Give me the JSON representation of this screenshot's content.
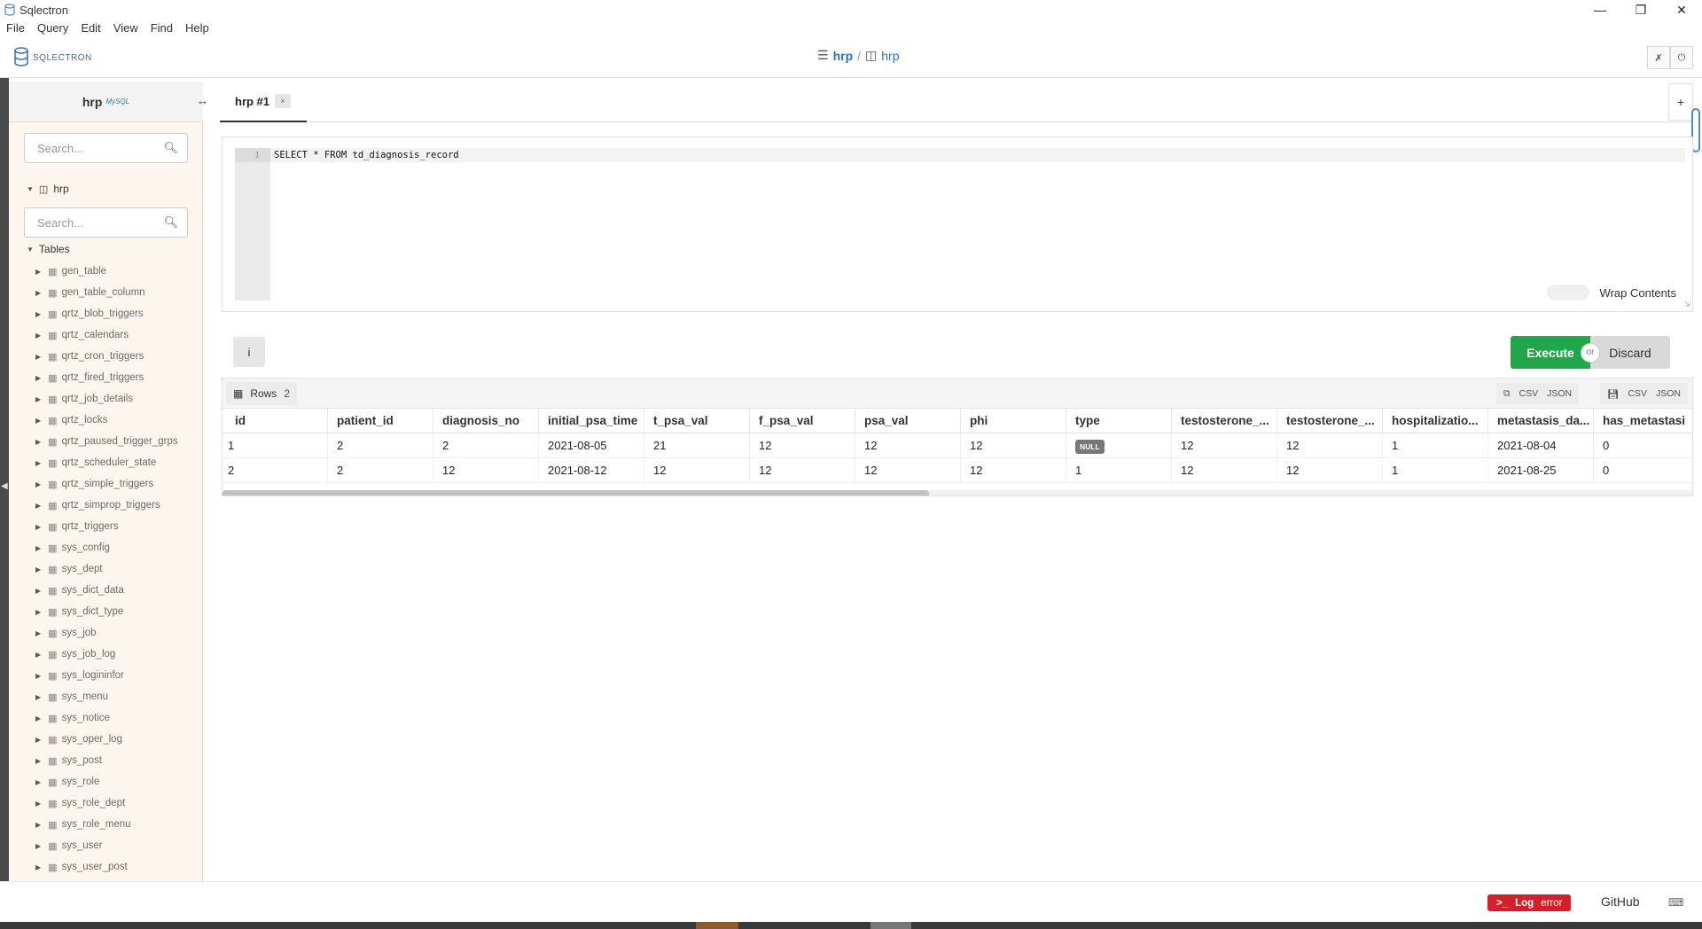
{
  "window": {
    "title": "Sqlectron",
    "controls": [
      "minimize-icon",
      "restore-icon",
      "close-icon"
    ]
  },
  "menu": [
    "File",
    "Query",
    "Edit",
    "View",
    "Find",
    "Help"
  ],
  "header": {
    "logo_text": "SQLECTRON",
    "server": "hrp",
    "separator": "/",
    "database": "hrp"
  },
  "sidebar": {
    "title": "hrp",
    "engine": "MySQL",
    "search_placeholder": "Search...",
    "db_name": "hrp",
    "table_search_placeholder": "Search...",
    "tables_label": "Tables",
    "tables": [
      "gen_table",
      "gen_table_column",
      "qrtz_blob_triggers",
      "qrtz_calendars",
      "qrtz_cron_triggers",
      "qrtz_fired_triggers",
      "qrtz_job_details",
      "qrtz_locks",
      "qrtz_paused_trigger_grps",
      "qrtz_scheduler_state",
      "qrtz_simple_triggers",
      "qrtz_simprop_triggers",
      "qrtz_triggers",
      "sys_config",
      "sys_dept",
      "sys_dict_data",
      "sys_dict_type",
      "sys_job",
      "sys_job_log",
      "sys_logininfor",
      "sys_menu",
      "sys_notice",
      "sys_oper_log",
      "sys_post",
      "sys_role",
      "sys_role_dept",
      "sys_role_menu",
      "sys_user",
      "sys_user_post"
    ]
  },
  "tabs": [
    {
      "label": "hrp #1",
      "close": "×"
    }
  ],
  "add_tab": "+",
  "editor": {
    "line_number": "1",
    "query": "SELECT * FROM td_diagnosis_record",
    "wrap_label": "Wrap Contents"
  },
  "actions": {
    "info": "i",
    "execute": "Execute",
    "or": "or",
    "discard": "Discard"
  },
  "results": {
    "rows_label": "Rows",
    "rows_count": "2",
    "csv": "CSV",
    "json": "JSON",
    "columns": [
      "id",
      "patient_id",
      "diagnosis_no",
      "initial_psa_time",
      "t_psa_val",
      "f_psa_val",
      "psa_val",
      "phi",
      "type",
      "testosterone_...",
      "testosterone_...",
      "hospitalizatio...",
      "metastasis_da...",
      "has_metastasi"
    ],
    "rows": [
      [
        "1",
        "2",
        "2",
        "2021-08-05",
        "21",
        "12",
        "12",
        "12",
        "NULL",
        "12",
        "12",
        "1",
        "2021-08-04",
        "0"
      ],
      [
        "2",
        "2",
        "12",
        "2021-08-12",
        "12",
        "12",
        "12",
        "12",
        "1",
        "12",
        "12",
        "1",
        "2021-08-25",
        "0"
      ]
    ],
    "horizontal_scroll": 0.48
  },
  "footer": {
    "log_prefix": ">_",
    "log_label": "Log",
    "error_label": "error",
    "github": "GitHub"
  },
  "colors": {
    "execute": "#21a64a",
    "log_error": "#d4202a",
    "sidebar_bg": "#fdf6ee",
    "accent": "#2a72c9"
  }
}
